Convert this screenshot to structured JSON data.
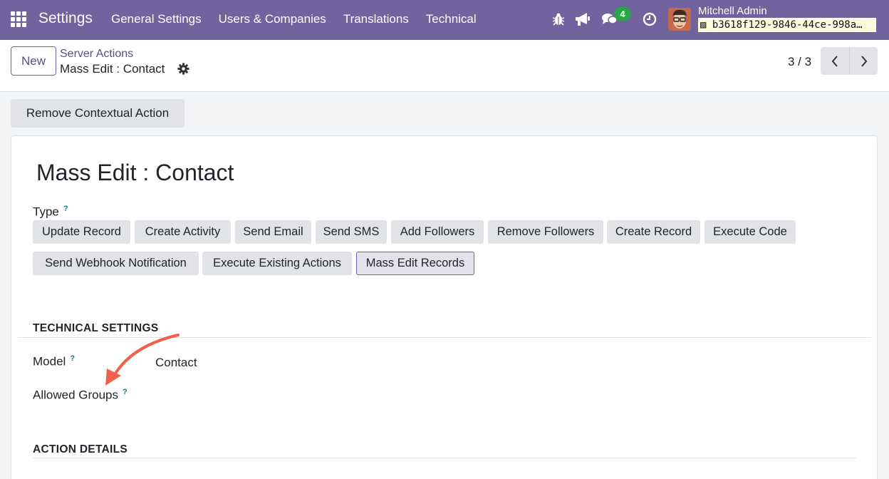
{
  "navbar": {
    "app_title": "Settings",
    "menu": [
      "General Settings",
      "Users & Companies",
      "Translations",
      "Technical"
    ],
    "messages_count": "4",
    "user_name": "Mitchell Admin",
    "db_name": "b3618f129-9846-44ce-998a…"
  },
  "control_panel": {
    "new_label": "New",
    "breadcrumb_parent": "Server Actions",
    "breadcrumb_current": "Mass Edit : Contact",
    "pager": "3 / 3"
  },
  "statusbar": {
    "remove_label": "Remove Contextual Action"
  },
  "form": {
    "title": "Mass Edit : Contact",
    "type_label": "Type",
    "help_mark": "?",
    "type_options": [
      "Update Record",
      "Create Activity",
      "Send Email",
      "Send SMS",
      "Add Followers",
      "Remove Followers",
      "Create Record",
      "Execute Code",
      "Send Webhook Notification",
      "Execute Existing Actions",
      "Mass Edit Records"
    ],
    "type_selected": "Mass Edit Records",
    "technical_settings_title": "TECHNICAL SETTINGS",
    "model_label": "Model",
    "model_value": "Contact",
    "allowed_groups_label": "Allowed Groups",
    "action_details_title": "ACTION DETAILS"
  },
  "colors": {
    "navbar": "#71639e",
    "accent": "#5a4e87",
    "annotation_arrow": "#f1604a",
    "badge": "#28a745"
  }
}
